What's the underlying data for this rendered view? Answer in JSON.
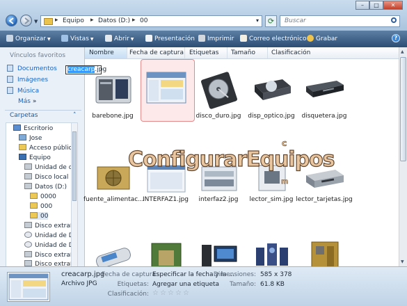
{
  "address": {
    "crumbs": [
      "Equipo",
      "Datos (D:)",
      "00"
    ],
    "separator": "▸"
  },
  "search": {
    "placeholder": "Buscar"
  },
  "window_controls": {
    "minimize": "–",
    "maximize": "□",
    "close": "✕"
  },
  "toolbar": {
    "organize": "Organizar",
    "views": "Vistas",
    "open": "Abrir",
    "slideshow": "Presentación",
    "print": "Imprimir",
    "email": "Correo electrónico",
    "burn": "Grabar",
    "help": "?"
  },
  "sidebar": {
    "favorites_header": "Vínculos favoritos",
    "favorites": [
      "Documentos",
      "Imágenes",
      "Música"
    ],
    "more": "Más",
    "more_arrow": "»",
    "folders_header": "Carpetas",
    "folders_caret": "˄",
    "tree": [
      "Escritorio",
      "Jose",
      "Acceso público",
      "Equipo",
      "Unidad de disco",
      "Disco local (C:)",
      "Datos (D:)",
      "0000",
      "000",
      "00",
      "Disco extraíble",
      "Unidad de DVD",
      "Unidad de DVD",
      "Disco extraíble",
      "Disco extraíble"
    ]
  },
  "columns": [
    "Nombre",
    "Fecha de captura",
    "Etiquetas",
    "Tamaño",
    "Clasificación"
  ],
  "files": [
    "barebone.jpg",
    "",
    "disco_duro.jpg",
    "disp_optico.jpg",
    "disquetera.jpg",
    "fuente_alimentac...",
    "INTERFAZ1.jpg",
    "interfaz2.jpg",
    "lector_sim.jpg",
    "lector_tarjetas.jpg"
  ],
  "rename": {
    "selected": "creacarp",
    "rest": ".jpg"
  },
  "watermark": {
    "text": "ConfigurarEquipos",
    "c": "c",
    "m": "m"
  },
  "details": {
    "filename": "creacarp.jpg",
    "filetype": "Archivo JPG",
    "date_label": "Fecha de captura:",
    "date_value": "Especificar la fecha y la ...",
    "tags_label": "Etiquetas:",
    "tags_value": "Agregar una etiqueta",
    "rating_label": "Clasificación:",
    "dims_label": "Dimensiones:",
    "dims_value": "585 x 378",
    "size_label": "Tamaño:",
    "size_value": "61.8 KB",
    "rating": 0
  }
}
